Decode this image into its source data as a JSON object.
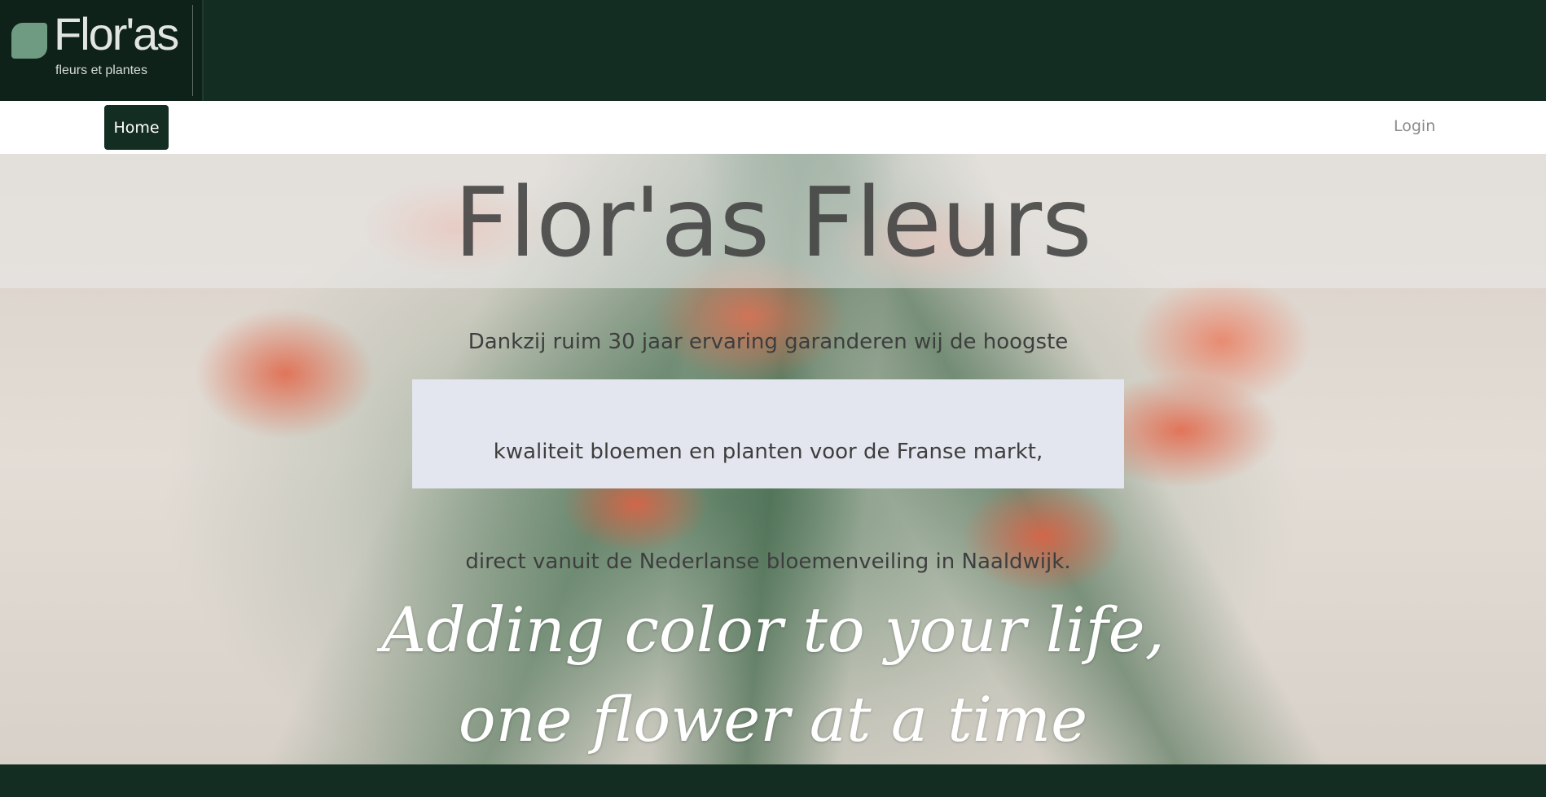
{
  "header": {
    "logo_name": "Flor'as",
    "logo_tagline": "fleurs et plantes"
  },
  "nav": {
    "home_label": "Home",
    "login_label": "Login"
  },
  "hero": {
    "title": "Flor'as Fleurs",
    "intro_lines": [
      "Dankzij ruim 30 jaar ervaring garanderen wij de hoogste",
      "kwaliteit bloemen en planten voor de Franse markt,",
      "direct vanuit de Nederlanse bloemenveiling in Naaldwijk."
    ],
    "slogan_lines": [
      "Adding color to your life,",
      "one flower at a time"
    ]
  },
  "colors": {
    "brand_dark_green": "#142d22",
    "logo_leaf": "#6f9b83",
    "intro_box": "#e3e6ef"
  },
  "icons": {
    "logo": "leaf-icon"
  }
}
